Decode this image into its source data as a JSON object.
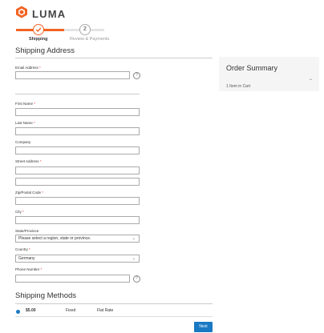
{
  "brand": {
    "logo_icon": "luma-logo-icon",
    "name": "LUMA"
  },
  "progress": {
    "steps": [
      {
        "number": "1",
        "label": "Shipping",
        "state": "complete"
      },
      {
        "number": "2",
        "label": "Review & Payments",
        "state": "pending"
      }
    ],
    "active_color": "#f26322",
    "inactive_color": "#e4e4e4"
  },
  "shipping_address": {
    "title": "Shipping Address",
    "fields": {
      "email": {
        "label": "Email Address",
        "required": "*",
        "value": ""
      },
      "first_name": {
        "label": "First Name",
        "required": "*",
        "value": ""
      },
      "last_name": {
        "label": "Last Name",
        "required": "*",
        "value": ""
      },
      "company": {
        "label": "Company",
        "value": ""
      },
      "street": {
        "label": "Street Address",
        "required": "*",
        "line1": "",
        "line2": ""
      },
      "zip": {
        "label": "Zip/Postal Code",
        "required": "*",
        "value": ""
      },
      "city": {
        "label": "City",
        "required": "*",
        "value": ""
      },
      "region": {
        "label": "State/Province",
        "value": "Please select a region, state or province."
      },
      "country": {
        "label": "Country",
        "required": "*",
        "value": "Germany"
      },
      "phone": {
        "label": "Phone Number",
        "required": "*",
        "value": ""
      }
    },
    "help_glyph": "?"
  },
  "order_summary": {
    "title": "Order Summary",
    "items_text": "1 Item in Cart",
    "chevron": "⌄"
  },
  "shipping_methods": {
    "title": "Shipping Methods",
    "rates": [
      {
        "price": "$5.00",
        "method": "Fixed",
        "carrier": "Flat Rate",
        "selected": true
      }
    ]
  },
  "actions": {
    "next_label": "Next"
  },
  "colors": {
    "accent": "#f26322",
    "primary_button": "#1979c3",
    "required": "#e02b27"
  }
}
